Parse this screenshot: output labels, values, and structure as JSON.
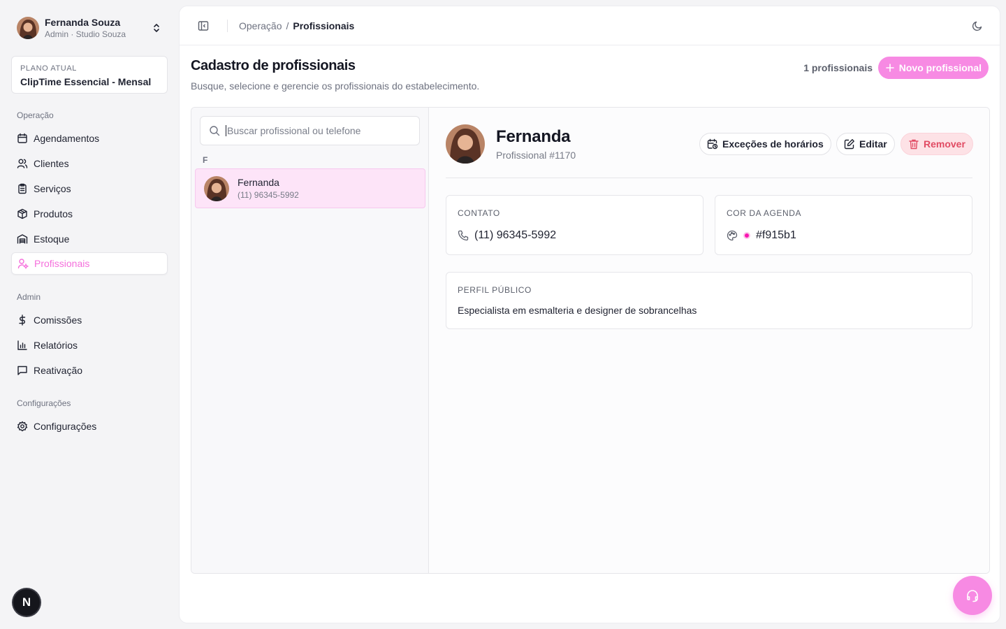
{
  "user": {
    "name": "Fernanda Souza",
    "role": "Admin · Studio Souza"
  },
  "plan": {
    "label": "PLANO ATUAL",
    "name": "ClipTime Essencial - Mensal"
  },
  "nav": {
    "group_operacao": "Operação",
    "group_admin": "Admin",
    "group_config": "Configurações",
    "items": [
      {
        "label": "Agendamentos",
        "icon": "calendar-icon"
      },
      {
        "label": "Clientes",
        "icon": "users-icon"
      },
      {
        "label": "Serviços",
        "icon": "clipboard-icon"
      },
      {
        "label": "Produtos",
        "icon": "package-icon"
      },
      {
        "label": "Estoque",
        "icon": "warehouse-icon"
      },
      {
        "label": "Profissionais",
        "icon": "user-cog-icon",
        "active": true
      },
      {
        "label": "Comissões",
        "icon": "dollar-icon"
      },
      {
        "label": "Relatórios",
        "icon": "bar-chart-icon"
      },
      {
        "label": "Reativação",
        "icon": "message-icon"
      },
      {
        "label": "Configurações",
        "icon": "gear-icon"
      }
    ]
  },
  "badge": {
    "letter": "N"
  },
  "breadcrumb": {
    "parent": "Operação",
    "separator": "/",
    "current": "Profissionais"
  },
  "page": {
    "title": "Cadastro de profissionais",
    "subtitle": "Busque, selecione e gerencie os profissionais do estabelecimento.",
    "count": "1 profissionais",
    "new_button": "Novo profissional"
  },
  "search": {
    "placeholder": "Buscar profissional ou telefone",
    "value": ""
  },
  "list": {
    "letter": "F",
    "items": [
      {
        "name": "Fernanda",
        "phone": "(11) 96345-5992"
      }
    ]
  },
  "detail": {
    "name": "Fernanda",
    "id": "Profissional #1170",
    "btn_exceptions": "Exceções de horários",
    "btn_edit": "Editar",
    "btn_remove": "Remover",
    "contact_label": "CONTATO",
    "contact_phone": "(11) 96345-5992",
    "color_label": "COR DA AGENDA",
    "color_value": "#f915b1",
    "profile_label": "PERFIL PÚBLICO",
    "profile_text": "Especialista em esmalteria e designer de sobrancelhas"
  },
  "colors": {
    "accent": "#f78ae3",
    "danger": "#e14b63",
    "agenda": "#f915b1"
  }
}
